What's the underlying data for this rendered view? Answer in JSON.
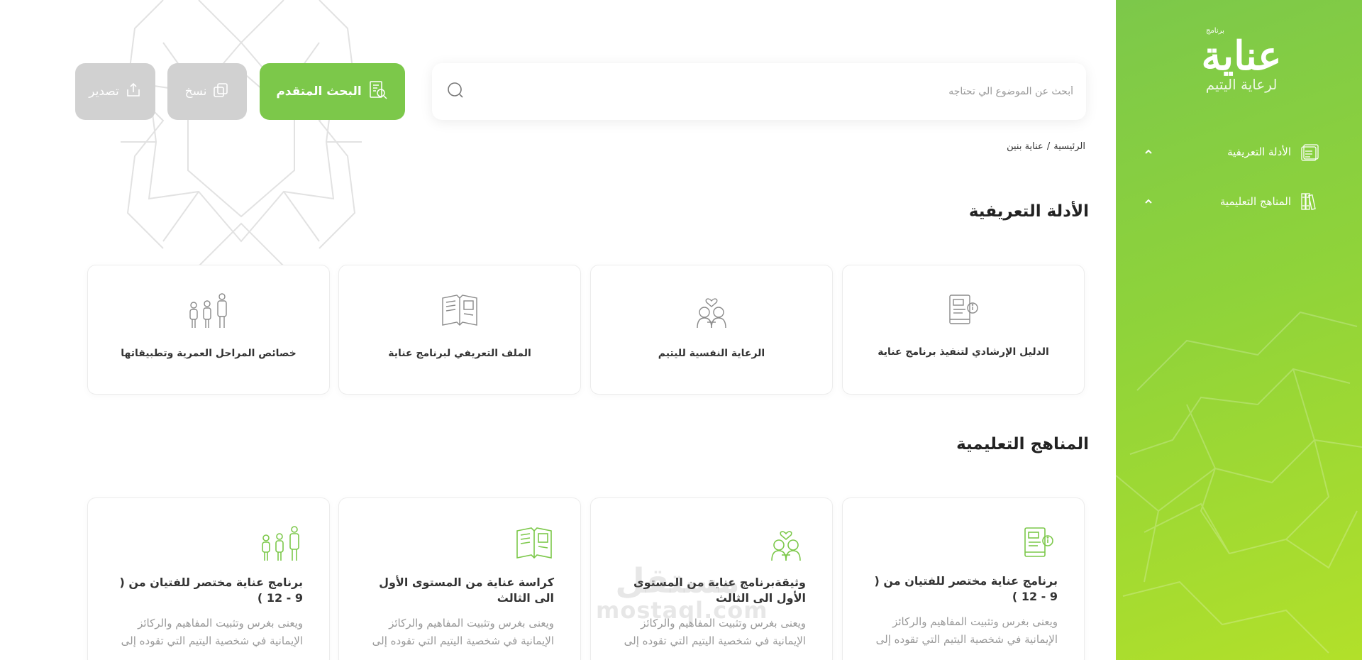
{
  "sidebar": {
    "logo": {
      "small": "برنامج",
      "main": "عناية",
      "sub": "لرعاية اليتيم"
    },
    "items": [
      {
        "label": "الأدلة التعريفية",
        "icon": "guides-icon"
      },
      {
        "label": "المناهج التعليمية",
        "icon": "books-icon"
      }
    ]
  },
  "search": {
    "placeholder": "أبحث عن الموضوع الي تحتاجه"
  },
  "toolbar": {
    "advanced_label": "البحث المتقدم",
    "copy_label": "نسخ",
    "export_label": "تصدير"
  },
  "breadcrumb": {
    "home": "الرئيسية",
    "separator": "/",
    "current": "عناية بنين"
  },
  "sections": {
    "guides_title": "الأدلة التعريفية",
    "curricula_title": "المناهج التعليمية"
  },
  "guides": [
    {
      "title": "الدليل الإرشادي لتنفيذ برنامج عناية",
      "icon": "manual-book-icon"
    },
    {
      "title": "الرعاية النفسية لليتيم",
      "icon": "children-heart-icon"
    },
    {
      "title": "الملف التعريفي لبرنامج عناية",
      "icon": "open-book-icon"
    },
    {
      "title": "خصائص المراحل العمرية وتطبيقاتها",
      "icon": "family-icon"
    }
  ],
  "curricula": [
    {
      "title": "برنامج عناية مختصر للفتيان من ( 9 - 12 )",
      "desc": "ويعنى بغرس وتثبيت المفاهيم والركائز الإيمانية في شخصية اليتيم التي تقوده إلى",
      "icon": "manual-book-icon"
    },
    {
      "title": "وثيقةبرنامج عناية من المستوى الأول الى الثالث",
      "desc": "ويعنى بغرس وتثبيت المفاهيم والركائز الإيمانية في شخصية اليتيم التي تقوده إلى",
      "icon": "children-heart-icon"
    },
    {
      "title": "كراسة عناية من المستوى الأول الى الثالث",
      "desc": "ويعنى بغرس وتثبيت المفاهيم والركائز الإيمانية في شخصية اليتيم التي تقوده إلى",
      "icon": "open-book-icon"
    },
    {
      "title": "برنامج عناية مختصر للفتيان من ( 9 - 12 )",
      "desc": "ويعنى بغرس وتثبيت المفاهيم والركائز الإيمانية في شخصية اليتيم التي تقوده إلى",
      "icon": "family-icon"
    }
  ],
  "watermark": {
    "arabic": "مستقل",
    "latin": "mostaql.com"
  },
  "colors": {
    "primary": "#7cc84a",
    "sidebar_end": "#b2e02a",
    "muted_button": "#d1d1d1",
    "icon_gray": "#8a8a8a"
  }
}
